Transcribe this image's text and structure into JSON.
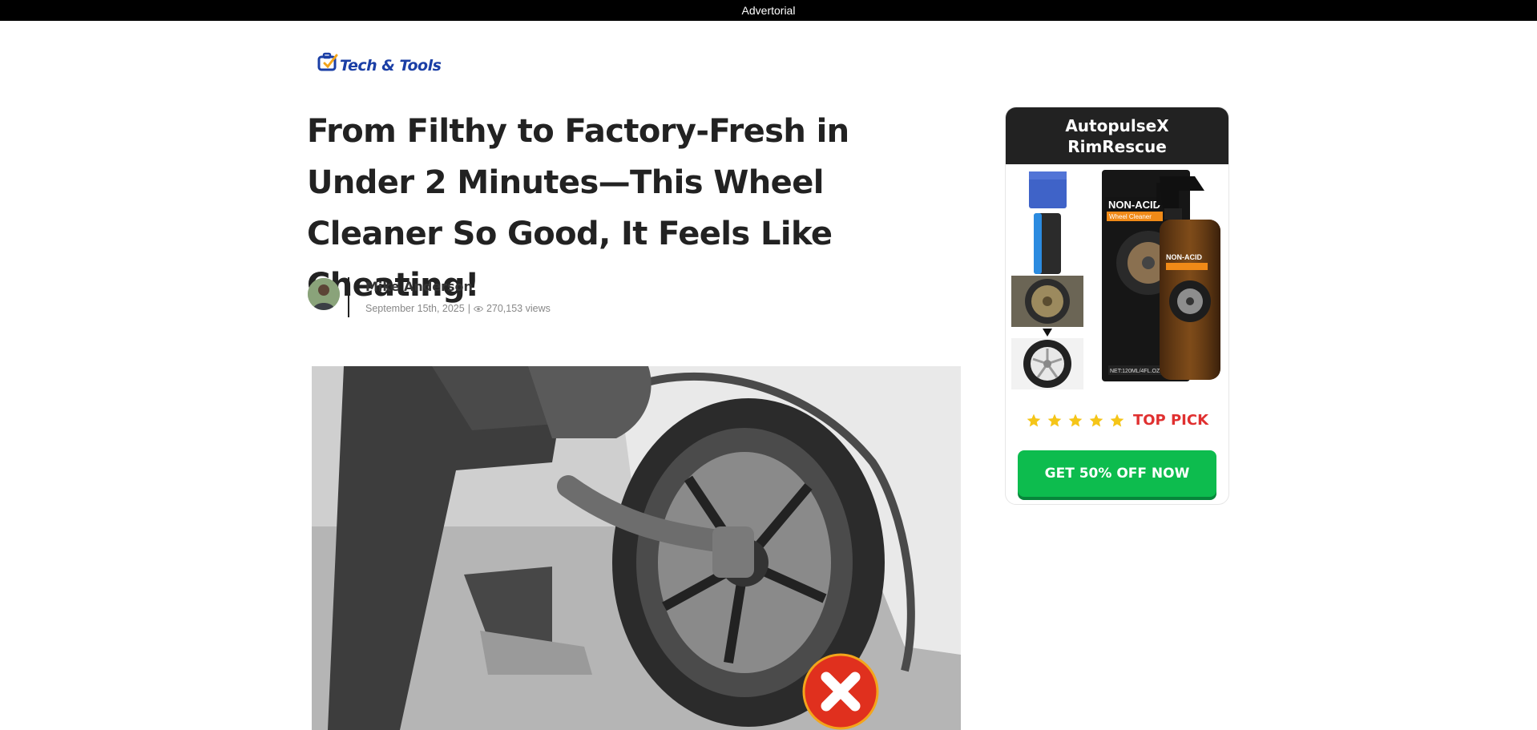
{
  "topbar": {
    "label": "Advertorial"
  },
  "brand": {
    "logo_text": "Tech & Tools"
  },
  "article": {
    "headline": "From Filthy to Factory-Fresh in Under 2 Minutes—This Wheel Cleaner So Good, It Feels Like Cheating!",
    "author": "Mike Anderson",
    "date": "September 15th, 2025",
    "separator": "|",
    "views": "270,153 views",
    "view_icon": "eye-icon"
  },
  "sidebar": {
    "product_name": "AutopulseX RimRescue",
    "product_label_main": "NON-ACID",
    "product_label_sub": "Wheel Cleaner",
    "product_label_tag": "BRAKE DUST ROAD GRIME",
    "product_label_bottom": "PROFESSIONAL GRADE CONCENTRATE",
    "product_net": "NET:120ML/4FL.OZ",
    "rating": {
      "stars": 5,
      "max": 5
    },
    "badge": "TOP PICK",
    "cta_label": "GET 50% OFF NOW"
  },
  "colors": {
    "topbar": "#000000",
    "cta_green": "#0dbc4e",
    "badge_red": "#e03030",
    "star_gold": "#f5c518",
    "header_dark": "#222222"
  }
}
